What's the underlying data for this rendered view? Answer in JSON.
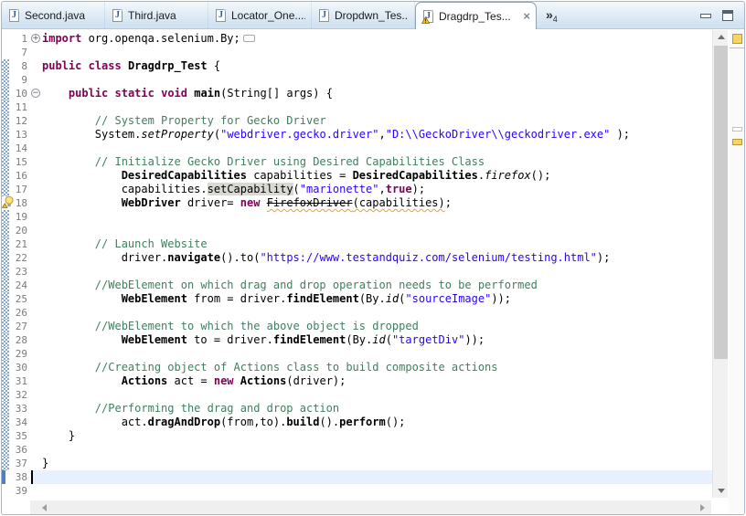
{
  "tabbar": {
    "tabs": [
      {
        "id": "second",
        "label": "Second.java",
        "active": false,
        "warning": false
      },
      {
        "id": "third",
        "label": "Third.java",
        "active": false,
        "warning": false
      },
      {
        "id": "locator-one",
        "label": "Locator_One....",
        "active": false,
        "warning": false
      },
      {
        "id": "dropdwn-test",
        "label": "Dropdwn_Tes...",
        "active": false,
        "warning": false
      },
      {
        "id": "dragdrp-test",
        "label": "Dragdrp_Tes...",
        "active": true,
        "warning": true
      }
    ],
    "file_icon_glyph": "J",
    "close_glyph": "×",
    "more_editors": {
      "chevron": "»",
      "count": "4"
    }
  },
  "window_controls": {
    "minimize": "Minimize",
    "maximize": "Maximize"
  },
  "editor": {
    "language": "java",
    "colors": {
      "keyword": "#7f0055",
      "string": "#2a00ff",
      "comment": "#3f7f5f",
      "current_line": "#e6f1fd",
      "occurrence_bg": "#d9d9d2",
      "warning_underline": "#e0a437",
      "quickdiff_blue": "#84a9d6"
    },
    "icons": {
      "fold_plus": "+",
      "fold_minus": "−"
    },
    "lines": [
      {
        "n": "1",
        "fold": "plus",
        "box": true,
        "segs": [
          [
            "import",
            "k"
          ],
          [
            " org.openqa.selenium.By;",
            "p"
          ]
        ]
      },
      {
        "n": "7",
        "segs": []
      },
      {
        "n": "8",
        "diff": "hatch",
        "segs": [
          [
            "public",
            "k"
          ],
          [
            " ",
            "p"
          ],
          [
            "class",
            "k"
          ],
          [
            " ",
            "p"
          ],
          [
            "Dragdrp_Test",
            "b"
          ],
          [
            " {",
            "p"
          ]
        ]
      },
      {
        "n": "9",
        "diff": "hatch",
        "segs": []
      },
      {
        "n": "10",
        "diff": "hatch",
        "fold": "minus",
        "segs": [
          [
            "    ",
            "p"
          ],
          [
            "public",
            "k"
          ],
          [
            " ",
            "p"
          ],
          [
            "static",
            "k"
          ],
          [
            " ",
            "p"
          ],
          [
            "void",
            "k"
          ],
          [
            " ",
            "p"
          ],
          [
            "main",
            "b"
          ],
          [
            "(String[] args) {",
            "p"
          ]
        ]
      },
      {
        "n": "11",
        "diff": "hatch",
        "segs": []
      },
      {
        "n": "12",
        "diff": "hatch",
        "segs": [
          [
            "        // System Property for Gecko Driver",
            "c"
          ]
        ]
      },
      {
        "n": "13",
        "diff": "hatch",
        "segs": [
          [
            "        System.",
            "p"
          ],
          [
            "setProperty",
            "i"
          ],
          [
            "(",
            "p"
          ],
          [
            "\"webdriver.gecko.driver\"",
            "s"
          ],
          [
            ",",
            "p"
          ],
          [
            "\"D:\\\\GeckoDriver\\\\geckodriver.exe\"",
            "s"
          ],
          [
            " );",
            "p"
          ]
        ]
      },
      {
        "n": "14",
        "diff": "hatch",
        "segs": []
      },
      {
        "n": "15",
        "diff": "hatch",
        "segs": [
          [
            "        // Initialize Gecko Driver using Desired Capabilities Class",
            "c"
          ]
        ]
      },
      {
        "n": "16",
        "diff": "hatch",
        "segs": [
          [
            "            ",
            "p"
          ],
          [
            "DesiredCapabilities",
            "b"
          ],
          [
            " capabilities = ",
            "p"
          ],
          [
            "DesiredCapabilities",
            "b"
          ],
          [
            ".",
            "p"
          ],
          [
            "firefox",
            "i"
          ],
          [
            "();",
            "p"
          ]
        ]
      },
      {
        "n": "17",
        "diff": "hatch",
        "segs": [
          [
            "            capabilities.",
            "p"
          ],
          [
            "setCapability",
            "occ"
          ],
          [
            "(",
            "p"
          ],
          [
            "\"marionette\"",
            "s"
          ],
          [
            ",",
            "p"
          ],
          [
            "true",
            "k"
          ],
          [
            ");",
            "p"
          ]
        ]
      },
      {
        "n": "18",
        "marker": "warning",
        "segs": [
          [
            "            ",
            "p"
          ],
          [
            "WebDriver",
            "b"
          ],
          [
            " driver= ",
            "p"
          ],
          [
            "new",
            "k"
          ],
          [
            " ",
            "p"
          ],
          [
            "FirefoxDriver",
            "dep"
          ],
          [
            "(capabilities)",
            "wv"
          ],
          [
            ";",
            "p"
          ]
        ]
      },
      {
        "n": "19",
        "diff": "hatch",
        "segs": []
      },
      {
        "n": "20",
        "diff": "hatch",
        "segs": []
      },
      {
        "n": "21",
        "diff": "hatch",
        "segs": [
          [
            "        // Launch Website",
            "c"
          ]
        ]
      },
      {
        "n": "22",
        "diff": "hatch",
        "segs": [
          [
            "            driver.",
            "p"
          ],
          [
            "navigate",
            "b"
          ],
          [
            "().to(",
            "p"
          ],
          [
            "\"https://www.testandquiz.com/selenium/testing.html\"",
            "s"
          ],
          [
            ");",
            "p"
          ]
        ]
      },
      {
        "n": "23",
        "diff": "hatch",
        "segs": []
      },
      {
        "n": "24",
        "diff": "hatch",
        "segs": [
          [
            "        //WebElement on which drag and drop operation needs to be performed",
            "c"
          ]
        ]
      },
      {
        "n": "25",
        "diff": "hatch",
        "segs": [
          [
            "            ",
            "p"
          ],
          [
            "WebElement",
            "b"
          ],
          [
            " from = driver.",
            "p"
          ],
          [
            "findElement",
            "b"
          ],
          [
            "(By.",
            "p"
          ],
          [
            "id",
            "i"
          ],
          [
            "(",
            "p"
          ],
          [
            "\"sourceImage\"",
            "s"
          ],
          [
            "));",
            "p"
          ]
        ]
      },
      {
        "n": "26",
        "diff": "hatch",
        "segs": []
      },
      {
        "n": "27",
        "diff": "hatch",
        "segs": [
          [
            "        //WebElement to which the above object is dropped",
            "c"
          ]
        ]
      },
      {
        "n": "28",
        "diff": "hatch",
        "segs": [
          [
            "            ",
            "p"
          ],
          [
            "WebElement",
            "b"
          ],
          [
            " to = driver.",
            "p"
          ],
          [
            "findElement",
            "b"
          ],
          [
            "(By.",
            "p"
          ],
          [
            "id",
            "i"
          ],
          [
            "(",
            "p"
          ],
          [
            "\"targetDiv\"",
            "s"
          ],
          [
            "));",
            "p"
          ]
        ]
      },
      {
        "n": "29",
        "diff": "hatch",
        "segs": []
      },
      {
        "n": "30",
        "diff": "hatch",
        "segs": [
          [
            "        //Creating object of Actions class to build composite actions",
            "c"
          ]
        ]
      },
      {
        "n": "31",
        "diff": "hatch",
        "segs": [
          [
            "            ",
            "p"
          ],
          [
            "Actions",
            "b"
          ],
          [
            " act = ",
            "p"
          ],
          [
            "new",
            "k"
          ],
          [
            " ",
            "p"
          ],
          [
            "Actions",
            "b"
          ],
          [
            "(driver);",
            "p"
          ]
        ]
      },
      {
        "n": "32",
        "diff": "hatch",
        "segs": []
      },
      {
        "n": "33",
        "diff": "hatch",
        "segs": [
          [
            "        //Performing the drag and drop action",
            "c"
          ]
        ]
      },
      {
        "n": "34",
        "diff": "hatch",
        "segs": [
          [
            "            act.",
            "p"
          ],
          [
            "dragAndDrop",
            "b"
          ],
          [
            "(from,to).",
            "p"
          ],
          [
            "build",
            "b"
          ],
          [
            "().",
            "p"
          ],
          [
            "perform",
            "b"
          ],
          [
            "();",
            "p"
          ]
        ]
      },
      {
        "n": "35",
        "diff": "hatch",
        "segs": [
          [
            "    }",
            "p"
          ]
        ]
      },
      {
        "n": "36",
        "diff": "hatch",
        "segs": []
      },
      {
        "n": "37",
        "diff": "hatch",
        "segs": [
          [
            "}",
            "p"
          ]
        ]
      },
      {
        "n": "38",
        "diff": "solid",
        "current": true,
        "caret": true,
        "segs": []
      },
      {
        "n": "39",
        "segs": []
      }
    ]
  },
  "overview_ruler": {
    "header": "warning-summary",
    "marks": [
      "occurrence",
      "warning"
    ]
  }
}
